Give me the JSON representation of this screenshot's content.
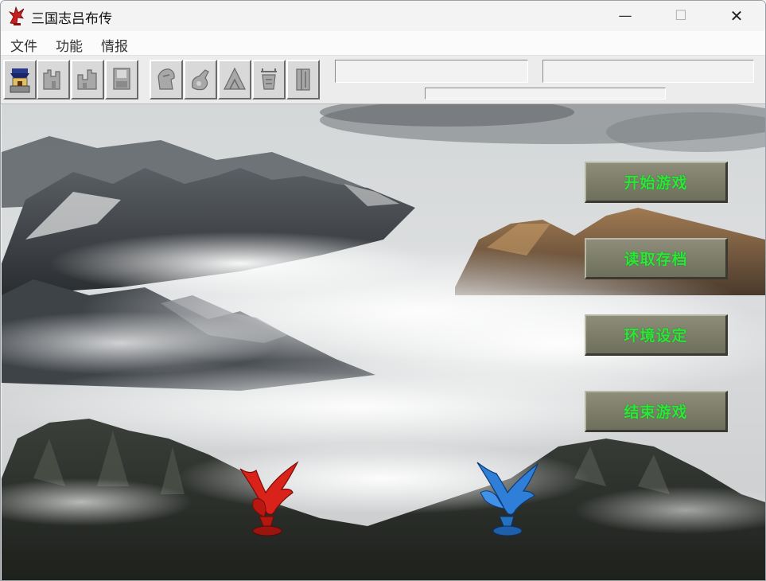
{
  "window": {
    "title": "三国志吕布传",
    "minimize_glyph": "—",
    "maximize_glyph": "☐",
    "close_glyph": "✕"
  },
  "menu": {
    "items": [
      "文件",
      "功能",
      "情报"
    ]
  },
  "toolbar": {
    "buttons": [
      {
        "icon": "castle-icon"
      },
      {
        "icon": "fortress-left-icon"
      },
      {
        "icon": "fortress-right-icon"
      },
      {
        "icon": "save-disk-icon"
      },
      {
        "icon": "helmet-icon"
      },
      {
        "icon": "horse-icon"
      },
      {
        "icon": "mountain-icon"
      },
      {
        "icon": "general-icon"
      },
      {
        "icon": "scroll-icon"
      }
    ]
  },
  "main_menu": {
    "start": "开始游戏",
    "load": "读取存档",
    "settings": "环境设定",
    "quit": "结束游戏"
  },
  "colors": {
    "button_text": "#2ee63a",
    "button_face": "#7a7a66",
    "red_bird": "#d8221a",
    "blue_bird": "#2f7fd8"
  }
}
